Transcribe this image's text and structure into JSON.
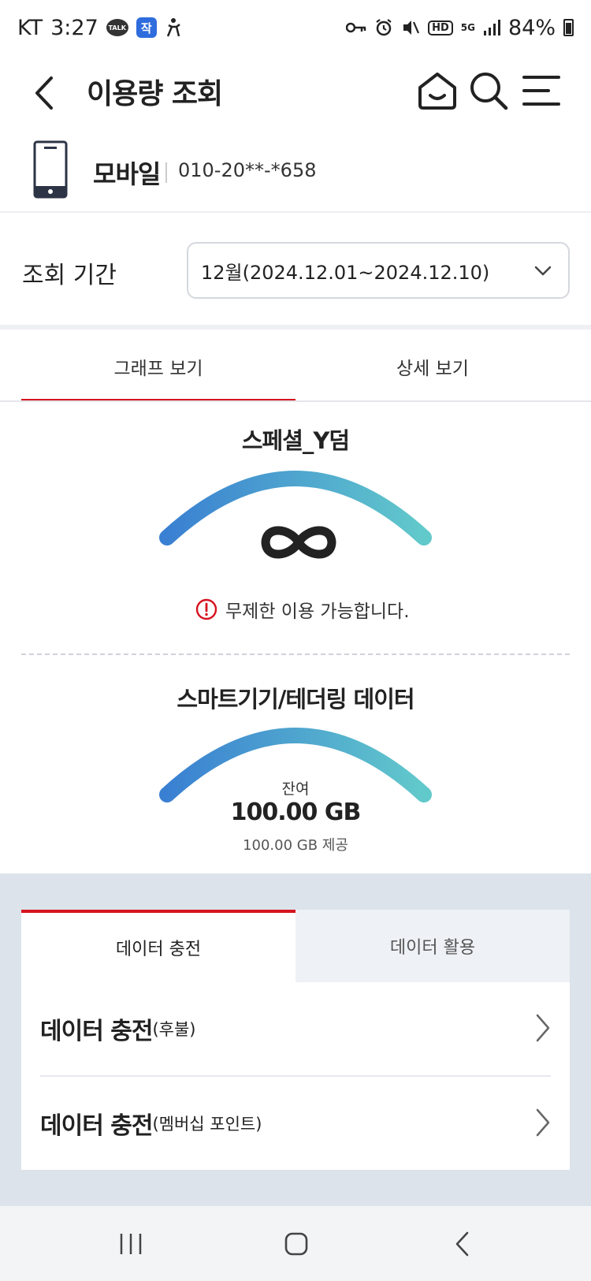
{
  "status_bar": {
    "carrier": "KT",
    "time": "3:27",
    "talk_badge": "TALK",
    "app_badge": "작",
    "hd_badge": "HD",
    "network": "5G",
    "battery": "84%"
  },
  "header": {
    "title": "이용량 조회"
  },
  "device": {
    "name": "모바일",
    "number": "010-20**-*658"
  },
  "period": {
    "label": "조회 기간",
    "selected": "12월(2024.12.01~2024.12.10)"
  },
  "tabs": [
    {
      "label": "그래프 보기",
      "active": true
    },
    {
      "label": "상세 보기",
      "active": false
    }
  ],
  "plan_usage": {
    "title": "스페셜_Y덤",
    "notice": "무제한 이용 가능합니다."
  },
  "tethering_usage": {
    "title": "스마트기기/테더링 데이터",
    "remain_label": "잔여",
    "remain_value": "100.00 GB",
    "provided": "100.00 GB 제공",
    "remaining_fraction": 1.0
  },
  "data_tabs": [
    {
      "label": "데이터 충전",
      "active": true
    },
    {
      "label": "데이터 활용",
      "active": false
    }
  ],
  "charge_items": [
    {
      "main": "데이터 충전",
      "sub": "(후불)"
    },
    {
      "main": "데이터 충전",
      "sub": "(멤버십 포인트)"
    }
  ],
  "colors": {
    "accent_red": "#d6131f",
    "gauge_start": "#3a80d2",
    "gauge_end": "#62c9cb"
  }
}
